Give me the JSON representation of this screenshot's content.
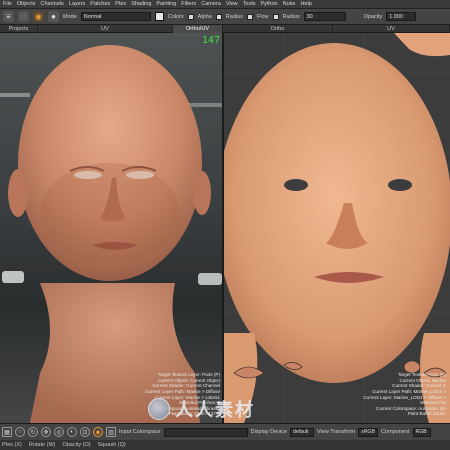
{
  "menu": [
    "File",
    "Objects",
    "Channels",
    "Layers",
    "Patches",
    "Ptex",
    "Shading",
    "Painting",
    "Filters",
    "Camera",
    "View",
    "Tools",
    "Python",
    "Nuke",
    "Help"
  ],
  "toolbar": {
    "mode_label": "Mode",
    "mode_value": "Normal",
    "colors_label": "Colors",
    "alpha_label": "Alpha",
    "radius_label": "Radius",
    "flow_label": "Flow",
    "radius2_label": "Radius",
    "radius_value": "30",
    "opacity_label": "Opacity",
    "opacity_value": "1.000",
    "fg_color": "#e8e8e8",
    "bg_color": "#1a1a1a",
    "accent": "#f39a32"
  },
  "tabs": [
    "Projects",
    "UV",
    "Ortho/UV",
    "Ortho",
    "UV"
  ],
  "left_viewport": {
    "fps": "147",
    "overlay": [
      "Target Texture Layer: Paint (P)",
      "Current Object: Current Object",
      "Current Shader: Current Channel",
      "Current Layer Path: Marine > Diffuse",
      "Current Layer: Marine > colors1",
      "Selected Patches: 2",
      "Colorspace: Automatic (linear)",
      "Paint Buffer Zoom: 137%"
    ]
  },
  "right_viewport": {
    "overlay": [
      "Target Texture Paint (P)",
      "Current Object: Marine",
      "Current Shader: Current C",
      "Current Layer Path: Marine_LOD2 >",
      "Current Layer: Marine_LOD2 > Diffuse >",
      "Selected Pat",
      "Current Colorspace: Automatic (lin",
      "Paint Buffer Zoom:"
    ]
  },
  "bottombar": {
    "colorspace_label": "Input Colorspace",
    "display_label": "Display Device",
    "display_value": "default",
    "view_label": "View Transform",
    "view_value": "sRGB",
    "component_label": "Component",
    "component_value": "RGB"
  },
  "status": [
    "Ptex (X)",
    "Rotate (W)",
    "Opacity (O)",
    "Squash (Q)"
  ],
  "watermark": "人人素材"
}
